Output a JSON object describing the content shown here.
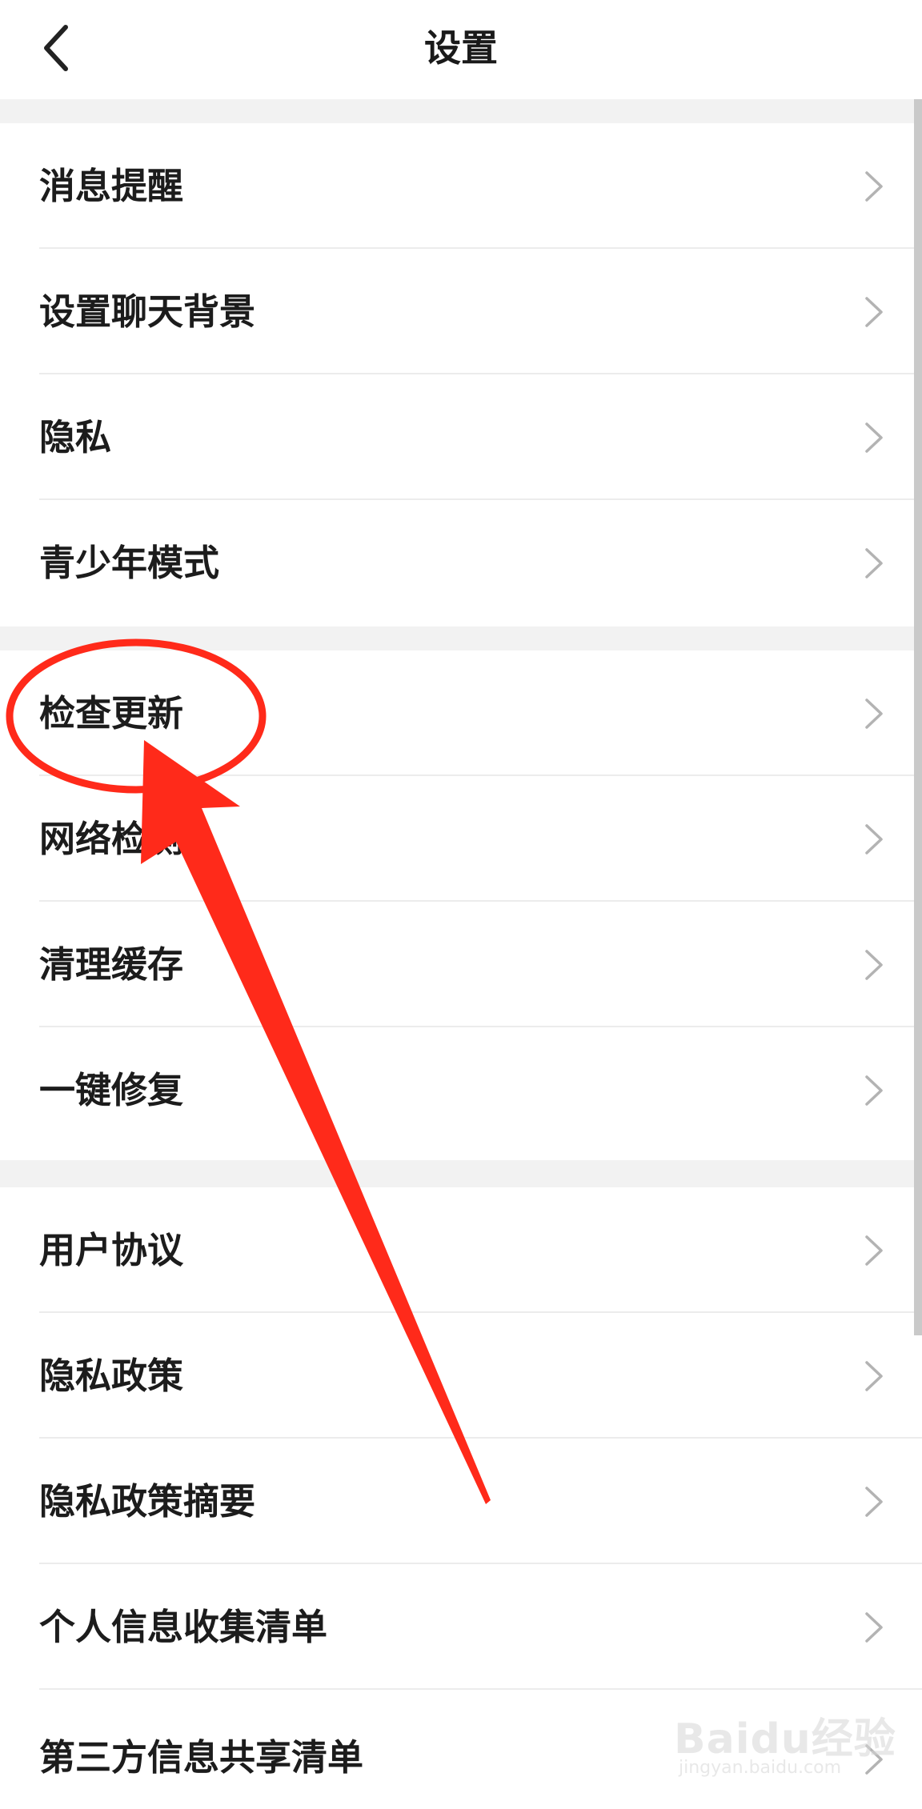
{
  "header": {
    "title": "设置",
    "back_icon": "chevron-left-icon"
  },
  "sections": [
    {
      "items": [
        {
          "label": "消息提醒"
        },
        {
          "label": "设置聊天背景"
        },
        {
          "label": "隐私"
        },
        {
          "label": "青少年模式"
        }
      ]
    },
    {
      "items": [
        {
          "label": "检查更新"
        },
        {
          "label": "网络检测"
        },
        {
          "label": "清理缓存"
        },
        {
          "label": "一键修复"
        }
      ]
    },
    {
      "items": [
        {
          "label": "用户协议"
        },
        {
          "label": "隐私政策"
        },
        {
          "label": "隐私政策摘要"
        },
        {
          "label": "个人信息收集清单"
        },
        {
          "label": "第三方信息共享清单"
        }
      ]
    }
  ],
  "row_icon": "chevron-right-icon",
  "annotation": {
    "color": "#ff2a1a",
    "shapes": [
      "highlight-ellipse",
      "pointer-arrow"
    ]
  },
  "watermark": {
    "brand": "Baidu经验",
    "url": "jingyan.baidu.com"
  }
}
